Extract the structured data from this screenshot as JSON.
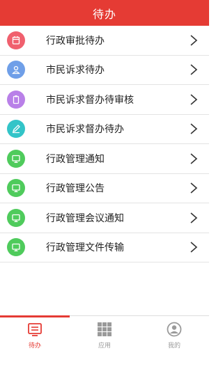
{
  "header": {
    "title": "待办"
  },
  "items": [
    {
      "label": "行政审批待办",
      "icon": "calendar-icon",
      "color": "#f0606e"
    },
    {
      "label": "市民诉求待办",
      "icon": "person-icon",
      "color": "#6f9fe8"
    },
    {
      "label": "市民诉求督办待审核",
      "icon": "clip-icon",
      "color": "#b980e8"
    },
    {
      "label": "市民诉求督办待办",
      "icon": "pen-icon",
      "color": "#33c4c8"
    },
    {
      "label": "行政管理通知",
      "icon": "monitor-icon",
      "color": "#4fcb5c"
    },
    {
      "label": "行政管理公告",
      "icon": "monitor-icon",
      "color": "#4fcb5c"
    },
    {
      "label": "行政管理会议通知",
      "icon": "monitor-icon",
      "color": "#4fcb5c"
    },
    {
      "label": "行政管理文件传输",
      "icon": "monitor-icon",
      "color": "#4fcb5c"
    }
  ],
  "tabs": [
    {
      "label": "待办",
      "icon": "todo-icon",
      "active": true
    },
    {
      "label": "应用",
      "icon": "apps-grid-icon",
      "active": false
    },
    {
      "label": "我的",
      "icon": "user-icon",
      "active": false
    }
  ],
  "colors": {
    "accent": "#e53b34",
    "tab_inactive": "#9a9a9a"
  }
}
